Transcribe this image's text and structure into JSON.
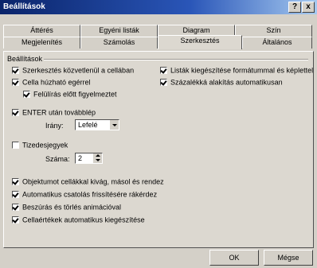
{
  "window": {
    "title": "Beállítások",
    "help_label": "?",
    "close_label": "x"
  },
  "tabs_row1": [
    "Áttérés",
    "Egyéni listák",
    "Diagram",
    "Szín"
  ],
  "tabs_row2": [
    "Megjelenítés",
    "Számolás",
    "Szerkesztés",
    "Általános"
  ],
  "active_tab": "Szerkesztés",
  "group": {
    "label": "Beállítások"
  },
  "options": {
    "direct_edit": {
      "label": "Szerkesztés közvetlenül a cellában",
      "checked": true
    },
    "drag_drop": {
      "label": "Cella húzható egérrel",
      "checked": true
    },
    "overwrite_warn": {
      "label": "Felülírás előtt figyelmeztet",
      "checked": true
    },
    "extend_formats": {
      "label": "Listák kiegészítése formátummal és képlettel",
      "checked": true
    },
    "auto_percent": {
      "label": "Százalékká alakítás automatikusan",
      "checked": true
    },
    "move_after_enter": {
      "label": "ENTER után továbblép",
      "checked": true
    },
    "direction_label": "Irány:",
    "direction_value": "Lefelé",
    "fixed_decimal": {
      "label": "Tizedesjegyek",
      "checked": false
    },
    "places_label": "Száma:",
    "places_value": "2",
    "cut_copy_sort": {
      "label": "Objektumot cellákkal kivág, másol és rendez",
      "checked": true
    },
    "ask_update_links": {
      "label": "Automatikus csatolás frissítésére rákérdez",
      "checked": true
    },
    "animation": {
      "label": "Beszúrás és törlés animációval",
      "checked": true
    },
    "autocomplete": {
      "label": "Cellaértékek automatikus kiegészítése",
      "checked": true
    }
  },
  "buttons": {
    "ok": "OK",
    "cancel": "Mégse"
  }
}
